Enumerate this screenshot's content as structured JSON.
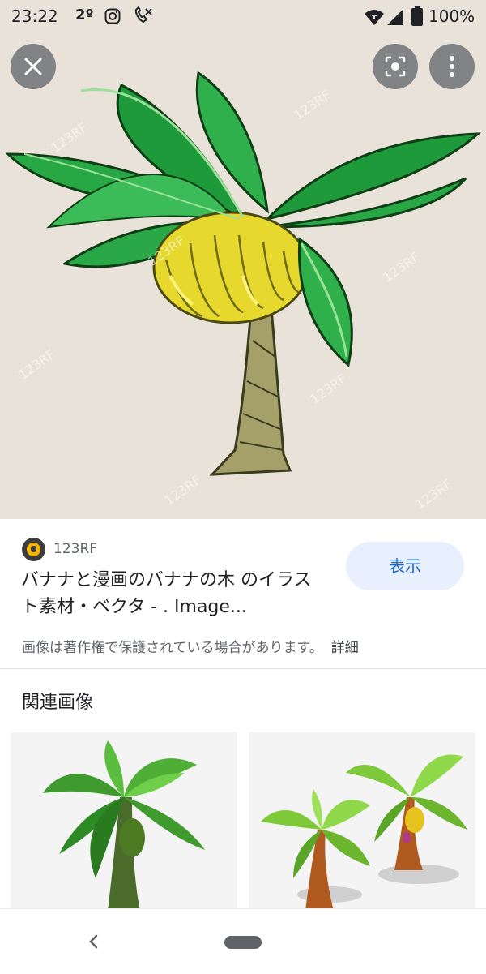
{
  "status_bar": {
    "time": "23:22",
    "temperature": "2º",
    "battery": "100%",
    "icons": [
      "instagram-icon",
      "phone-off-icon",
      "wifi-icon",
      "signal-icon",
      "battery-icon"
    ]
  },
  "viewer": {
    "close_icon": "close-icon",
    "lens_icon": "lens-icon",
    "more_icon": "more-vert-icon",
    "watermark": "123RF"
  },
  "result": {
    "source": "123RF",
    "title": "バナナと漫画のバナナの木 のイラスト素材・ベクタ - . Image...",
    "visit_label": "表示",
    "copyright_notice": "画像は著作権で保護されている場合があります。",
    "details_link": "詳細"
  },
  "related": {
    "heading": "関連画像"
  },
  "colors": {
    "accent": "#1967d2",
    "button_bg": "#e8f0fe",
    "hero_bg": "#e9e2d8"
  }
}
